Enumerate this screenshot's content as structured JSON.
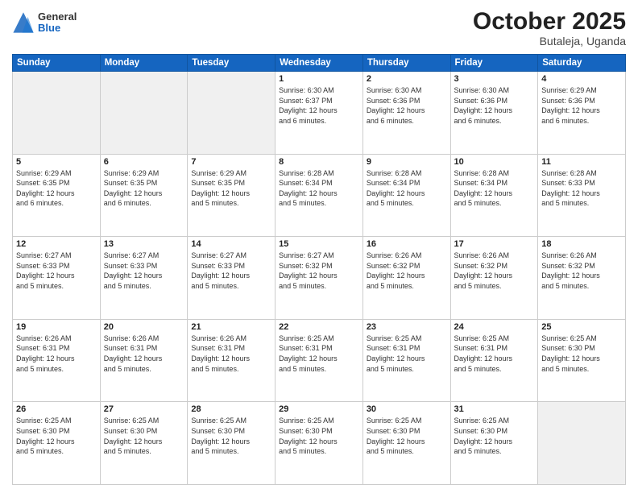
{
  "header": {
    "logo": {
      "general": "General",
      "blue": "Blue"
    },
    "title": "October 2025",
    "subtitle": "Butaleja, Uganda"
  },
  "weekdays": [
    "Sunday",
    "Monday",
    "Tuesday",
    "Wednesday",
    "Thursday",
    "Friday",
    "Saturday"
  ],
  "weeks": [
    [
      {
        "day": "",
        "info": ""
      },
      {
        "day": "",
        "info": ""
      },
      {
        "day": "",
        "info": ""
      },
      {
        "day": "1",
        "info": "Sunrise: 6:30 AM\nSunset: 6:37 PM\nDaylight: 12 hours\nand 6 minutes."
      },
      {
        "day": "2",
        "info": "Sunrise: 6:30 AM\nSunset: 6:36 PM\nDaylight: 12 hours\nand 6 minutes."
      },
      {
        "day": "3",
        "info": "Sunrise: 6:30 AM\nSunset: 6:36 PM\nDaylight: 12 hours\nand 6 minutes."
      },
      {
        "day": "4",
        "info": "Sunrise: 6:29 AM\nSunset: 6:36 PM\nDaylight: 12 hours\nand 6 minutes."
      }
    ],
    [
      {
        "day": "5",
        "info": "Sunrise: 6:29 AM\nSunset: 6:35 PM\nDaylight: 12 hours\nand 6 minutes."
      },
      {
        "day": "6",
        "info": "Sunrise: 6:29 AM\nSunset: 6:35 PM\nDaylight: 12 hours\nand 6 minutes."
      },
      {
        "day": "7",
        "info": "Sunrise: 6:29 AM\nSunset: 6:35 PM\nDaylight: 12 hours\nand 5 minutes."
      },
      {
        "day": "8",
        "info": "Sunrise: 6:28 AM\nSunset: 6:34 PM\nDaylight: 12 hours\nand 5 minutes."
      },
      {
        "day": "9",
        "info": "Sunrise: 6:28 AM\nSunset: 6:34 PM\nDaylight: 12 hours\nand 5 minutes."
      },
      {
        "day": "10",
        "info": "Sunrise: 6:28 AM\nSunset: 6:34 PM\nDaylight: 12 hours\nand 5 minutes."
      },
      {
        "day": "11",
        "info": "Sunrise: 6:28 AM\nSunset: 6:33 PM\nDaylight: 12 hours\nand 5 minutes."
      }
    ],
    [
      {
        "day": "12",
        "info": "Sunrise: 6:27 AM\nSunset: 6:33 PM\nDaylight: 12 hours\nand 5 minutes."
      },
      {
        "day": "13",
        "info": "Sunrise: 6:27 AM\nSunset: 6:33 PM\nDaylight: 12 hours\nand 5 minutes."
      },
      {
        "day": "14",
        "info": "Sunrise: 6:27 AM\nSunset: 6:33 PM\nDaylight: 12 hours\nand 5 minutes."
      },
      {
        "day": "15",
        "info": "Sunrise: 6:27 AM\nSunset: 6:32 PM\nDaylight: 12 hours\nand 5 minutes."
      },
      {
        "day": "16",
        "info": "Sunrise: 6:26 AM\nSunset: 6:32 PM\nDaylight: 12 hours\nand 5 minutes."
      },
      {
        "day": "17",
        "info": "Sunrise: 6:26 AM\nSunset: 6:32 PM\nDaylight: 12 hours\nand 5 minutes."
      },
      {
        "day": "18",
        "info": "Sunrise: 6:26 AM\nSunset: 6:32 PM\nDaylight: 12 hours\nand 5 minutes."
      }
    ],
    [
      {
        "day": "19",
        "info": "Sunrise: 6:26 AM\nSunset: 6:31 PM\nDaylight: 12 hours\nand 5 minutes."
      },
      {
        "day": "20",
        "info": "Sunrise: 6:26 AM\nSunset: 6:31 PM\nDaylight: 12 hours\nand 5 minutes."
      },
      {
        "day": "21",
        "info": "Sunrise: 6:26 AM\nSunset: 6:31 PM\nDaylight: 12 hours\nand 5 minutes."
      },
      {
        "day": "22",
        "info": "Sunrise: 6:25 AM\nSunset: 6:31 PM\nDaylight: 12 hours\nand 5 minutes."
      },
      {
        "day": "23",
        "info": "Sunrise: 6:25 AM\nSunset: 6:31 PM\nDaylight: 12 hours\nand 5 minutes."
      },
      {
        "day": "24",
        "info": "Sunrise: 6:25 AM\nSunset: 6:31 PM\nDaylight: 12 hours\nand 5 minutes."
      },
      {
        "day": "25",
        "info": "Sunrise: 6:25 AM\nSunset: 6:30 PM\nDaylight: 12 hours\nand 5 minutes."
      }
    ],
    [
      {
        "day": "26",
        "info": "Sunrise: 6:25 AM\nSunset: 6:30 PM\nDaylight: 12 hours\nand 5 minutes."
      },
      {
        "day": "27",
        "info": "Sunrise: 6:25 AM\nSunset: 6:30 PM\nDaylight: 12 hours\nand 5 minutes."
      },
      {
        "day": "28",
        "info": "Sunrise: 6:25 AM\nSunset: 6:30 PM\nDaylight: 12 hours\nand 5 minutes."
      },
      {
        "day": "29",
        "info": "Sunrise: 6:25 AM\nSunset: 6:30 PM\nDaylight: 12 hours\nand 5 minutes."
      },
      {
        "day": "30",
        "info": "Sunrise: 6:25 AM\nSunset: 6:30 PM\nDaylight: 12 hours\nand 5 minutes."
      },
      {
        "day": "31",
        "info": "Sunrise: 6:25 AM\nSunset: 6:30 PM\nDaylight: 12 hours\nand 5 minutes."
      },
      {
        "day": "",
        "info": ""
      }
    ]
  ]
}
